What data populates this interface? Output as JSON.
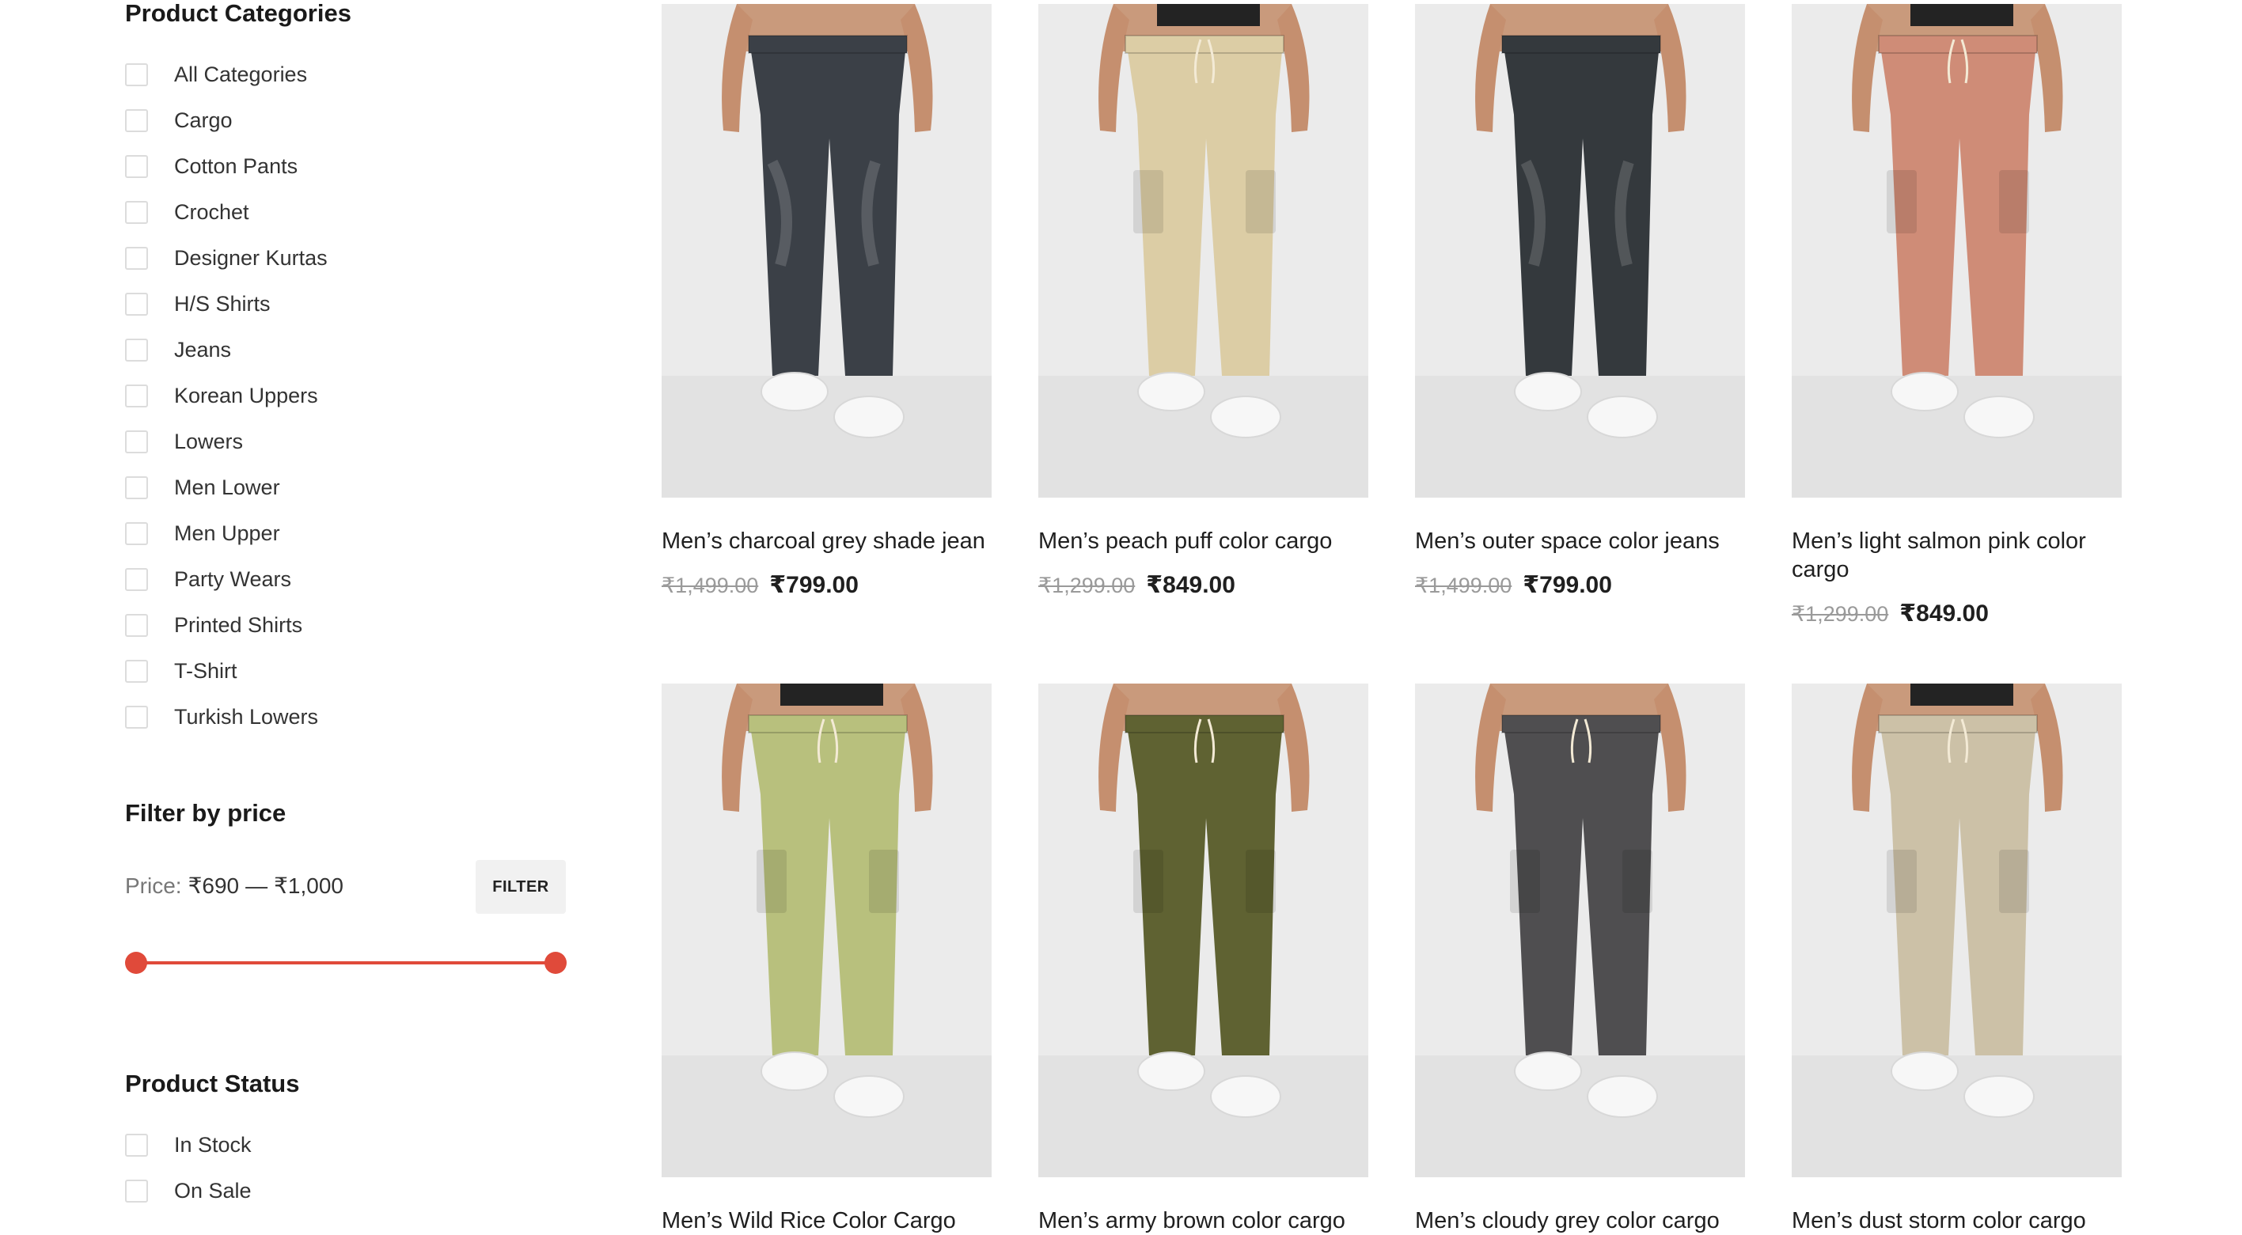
{
  "colors": {
    "accent": "#e04a3a",
    "text": "#1f1f1f",
    "muted": "#9a9a9a",
    "photo_background": "#e9e9e9"
  },
  "sidebar": {
    "categories_title": "Product Categories",
    "categories": [
      "All Categories",
      "Cargo",
      "Cotton Pants",
      "Crochet",
      "Designer Kurtas",
      "H/S Shirts",
      "Jeans",
      "Korean Uppers",
      "Lowers",
      "Men Lower",
      "Men Upper",
      "Party Wears",
      "Printed Shirts",
      "T-Shirt",
      "Turkish Lowers"
    ],
    "price_title": "Filter by price",
    "price_prefix": "Price:",
    "price_min": "₹690",
    "price_separator": "—",
    "price_max": "₹1,000",
    "filter_label": "FILTER",
    "status_title": "Product Status",
    "statuses": [
      "In Stock",
      "On Sale"
    ]
  },
  "products": [
    {
      "title": "Men’s charcoal grey shade jean",
      "old_price": "₹1,499.00",
      "price": "₹799.00",
      "pants_color": "#3b4047",
      "top_color": "",
      "kind": "jeans-icon"
    },
    {
      "title": "Men’s peach puff color cargo",
      "old_price": "₹1,299.00",
      "price": "₹849.00",
      "pants_color": "#dccda5",
      "top_color": "#232323",
      "kind": "cargo-icon"
    },
    {
      "title": "Men’s outer space color jeans",
      "old_price": "₹1,499.00",
      "price": "₹799.00",
      "pants_color": "#34393d",
      "top_color": "",
      "kind": "jeans-icon"
    },
    {
      "title": "Men’s light salmon pink color cargo",
      "old_price": "₹1,299.00",
      "price": "₹849.00",
      "pants_color": "#cf8c77",
      "top_color": "#232323",
      "kind": "cargo-icon"
    },
    {
      "title": "Men’s Wild Rice Color Cargo",
      "old_price": "",
      "price": "",
      "pants_color": "#b8c07d",
      "top_color": "#232323",
      "kind": "cargo-icon"
    },
    {
      "title": "Men’s army brown color cargo",
      "old_price": "",
      "price": "",
      "pants_color": "#5f6232",
      "top_color": "",
      "kind": "cargo-icon"
    },
    {
      "title": "Men’s cloudy grey color cargo",
      "old_price": "",
      "price": "",
      "pants_color": "#4f4e50",
      "top_color": "",
      "kind": "cargo-icon"
    },
    {
      "title": "Men’s dust storm color cargo",
      "old_price": "",
      "price": "",
      "pants_color": "#ccc1a7",
      "top_color": "#232323",
      "kind": "cargo-icon"
    }
  ]
}
